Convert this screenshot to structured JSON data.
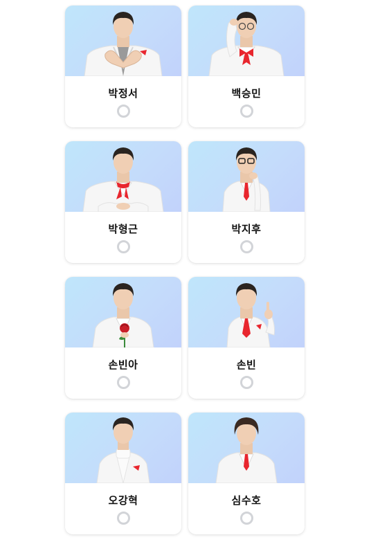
{
  "candidates": [
    {
      "name": "박정서",
      "pose": "heart-hands",
      "tie": "none",
      "selected": false
    },
    {
      "name": "백승민",
      "pose": "hand-on-head",
      "tie": "bowtie",
      "selected": false
    },
    {
      "name": "박형근",
      "pose": "hands-together",
      "tie": "scarf",
      "selected": false
    },
    {
      "name": "박지후",
      "pose": "hand-on-chin",
      "tie": "tie",
      "selected": false
    },
    {
      "name": "손빈아",
      "pose": "holding-rose",
      "tie": "none",
      "selected": false
    },
    {
      "name": "손빈",
      "pose": "pointing-up",
      "tie": "tie",
      "selected": false
    },
    {
      "name": "오강혁",
      "pose": "turtleneck",
      "tie": "none",
      "selected": false
    },
    {
      "name": "심수호",
      "pose": "standing",
      "tie": "tie",
      "selected": false
    }
  ],
  "colors": {
    "photo_bg": "#c4dcfb",
    "suit": "#f6f6f6",
    "accent_red": "#e8262e",
    "hair": "#2a2420",
    "radio_border": "#d2d4d8"
  }
}
